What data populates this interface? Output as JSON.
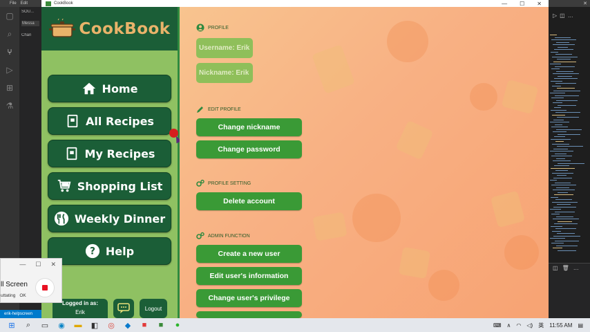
{
  "vscode": {
    "menu": [
      "File",
      "Edit"
    ],
    "explorer": [
      "SOU...",
      "Messa",
      "Chan"
    ],
    "status": "erik-helpscreen"
  },
  "app": {
    "title": "CookBook",
    "logo_text": "CookBook",
    "nav": [
      {
        "label": "Home",
        "icon": "home-icon"
      },
      {
        "label": "All Recipes",
        "icon": "recipe-book-icon"
      },
      {
        "label": "My Recipes",
        "icon": "recipe-book-icon"
      },
      {
        "label": "Shopping List",
        "icon": "cart-icon"
      },
      {
        "label": "Weekly Dinner",
        "icon": "cutlery-icon"
      },
      {
        "label": "Help",
        "icon": "question-icon"
      }
    ],
    "footer": {
      "logged_in_label": "Logged in as:",
      "username": "Erik",
      "logout_label": "Logout"
    }
  },
  "profile": {
    "sections": {
      "profile": "PROFILE",
      "edit_profile": "EDIT PROFILE",
      "profile_setting": "PROFILE SETTING",
      "admin_function": "ADMIN FUNCTION"
    },
    "username_text": "Username: Erik",
    "nickname_text": "Nickname: Erik",
    "buttons": {
      "change_nickname": "Change nickname",
      "change_password": "Change password",
      "delete_account": "Delete account",
      "create_user": "Create a new user",
      "edit_user_info": "Edit user's information",
      "change_privilege": "Change user's privilege"
    }
  },
  "recorder": {
    "label": "ll Screen",
    "status_left": "uttating",
    "status_right": "OK"
  },
  "taskbar": {
    "language": "英",
    "time": "11:55 AM"
  },
  "colors": {
    "sidebar_dark": "#1b5e37",
    "sidebar_light": "#8fc162",
    "button_green": "#3a9a36",
    "logo_orange": "#e9b36a"
  }
}
